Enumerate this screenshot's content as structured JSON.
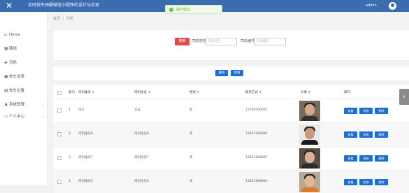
{
  "header": {
    "title": "实时校车预报微信小程序的设计与实现",
    "user": "admin",
    "brand_color": "#3b6cb0"
  },
  "toast": {
    "text": "操作成功",
    "status_color": "#67c23a"
  },
  "sidebar": {
    "items": [
      {
        "label": "Home",
        "icon": "home-icon"
      },
      {
        "label": "路线",
        "icon": "grid-icon"
      },
      {
        "label": "司机",
        "icon": "car-icon"
      },
      {
        "label": "校车信息",
        "icon": "bus-icon"
      },
      {
        "label": "校车位置",
        "icon": "location-icon"
      },
      {
        "label": "系统管理",
        "icon": "user-group-icon"
      },
      {
        "label": "个人中心",
        "icon": "user-icon"
      }
    ]
  },
  "breadcrumb": {
    "home": "首页",
    "separator": "/",
    "current": "司机"
  },
  "search": {
    "search_button": "搜索",
    "name_label": "司机姓名",
    "name_placeholder": "司机姓名",
    "number_label": "司机编号",
    "number_placeholder": "司机编号"
  },
  "actions": {
    "delete_label": "删除",
    "add_label": "新增"
  },
  "table": {
    "headers": {
      "index": "索引",
      "number": "司机编号 ⇕",
      "name": "司机姓名 ⇕",
      "gender": "性别 ⇕",
      "phone": "联系方式 ⇕",
      "avatar": "头像 ⇕",
      "operations": "操作"
    },
    "buttons": {
      "detail": "查看",
      "edit": "修改",
      "delete": "删除"
    },
    "rows": [
      {
        "index": "1",
        "number": "002",
        "name": "王五",
        "gender": "女",
        "phone": "13700000002"
      },
      {
        "index": "2",
        "number": "司机编号8",
        "name": "司机姓名8",
        "gender": "男",
        "phone": "13823888888"
      },
      {
        "index": "3",
        "number": "司机编号7",
        "name": "司机姓名7",
        "gender": "男",
        "phone": "13823888887"
      },
      {
        "index": "4",
        "number": "司机编号6",
        "name": "司机姓名6",
        "gender": "男",
        "phone": "13823888886"
      }
    ]
  }
}
